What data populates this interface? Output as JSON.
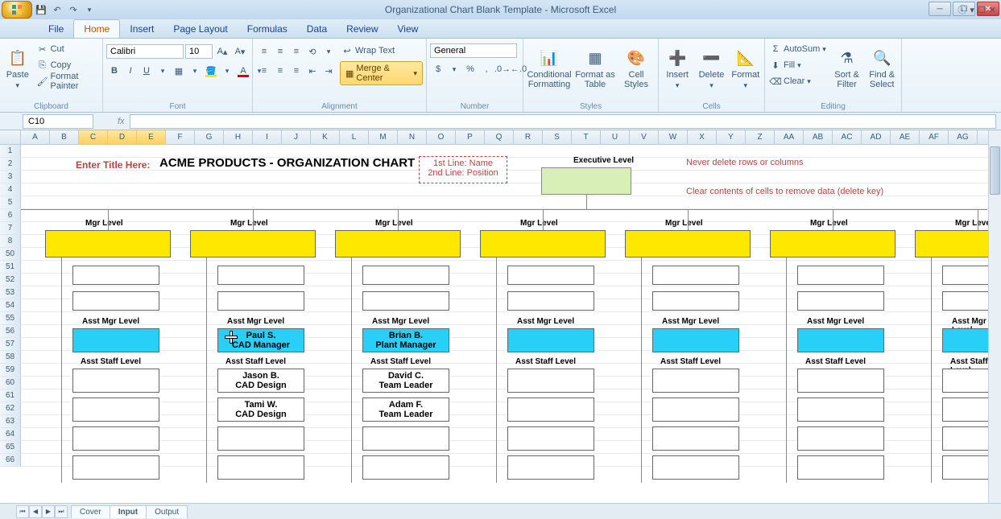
{
  "window": {
    "title": "Organizational Chart Blank Template - Microsoft Excel"
  },
  "tabs": [
    "File",
    "Home",
    "Insert",
    "Page Layout",
    "Formulas",
    "Data",
    "Review",
    "View"
  ],
  "active_tab": "Home",
  "clipboard": {
    "paste": "Paste",
    "cut": "Cut",
    "copy": "Copy",
    "fp": "Format Painter",
    "label": "Clipboard"
  },
  "font": {
    "name": "Calibri",
    "size": "10",
    "label": "Font"
  },
  "alignment": {
    "wrap": "Wrap Text",
    "merge": "Merge & Center",
    "label": "Alignment"
  },
  "number": {
    "fmt": "General",
    "label": "Number"
  },
  "styles": {
    "cf": "Conditional Formatting",
    "fat": "Format as Table",
    "cs": "Cell Styles",
    "label": "Styles"
  },
  "cells": {
    "ins": "Insert",
    "del": "Delete",
    "fmt": "Format",
    "label": "Cells"
  },
  "editing": {
    "as": "AutoSum",
    "fill": "Fill",
    "clr": "Clear",
    "sort": "Sort & Filter",
    "find": "Find & Select",
    "label": "Editing"
  },
  "namebox": "C10",
  "cols": [
    "A",
    "B",
    "C",
    "D",
    "E",
    "F",
    "G",
    "H",
    "I",
    "J",
    "K",
    "L",
    "M",
    "N",
    "O",
    "P",
    "Q",
    "R",
    "S",
    "T",
    "U",
    "V",
    "W",
    "X",
    "Y",
    "Z",
    "AA",
    "AB",
    "AC",
    "AD",
    "AE",
    "AF",
    "AG"
  ],
  "sel_cols": [
    "C",
    "D",
    "E"
  ],
  "row_labels": [
    "1",
    "2",
    "3",
    "4",
    "5",
    "6",
    "7",
    "8",
    "50",
    "51",
    "52",
    "53",
    "54",
    "55",
    "56",
    "57",
    "58",
    "59",
    "60",
    "61",
    "62",
    "63",
    "64",
    "65",
    "66"
  ],
  "sheet": {
    "prompt": "Enter Title Here:",
    "title": "ACME PRODUCTS - ORGANIZATION CHART",
    "legend1": "1st Line: Name",
    "legend2": "2nd Line: Position",
    "exec": "Executive Level",
    "warn1": "Never delete rows or columns",
    "warn2": "Clear contents of cells to remove data (delete key)",
    "mgr": "Mgr Level",
    "amgr": "Asst Mgr Level",
    "astaff": "Asst Staff Level",
    "paul_n": "Paul S.",
    "paul_p": "CAD Manager",
    "brian_n": "Brian B.",
    "brian_p": "Plant Manager",
    "jason_n": "Jason B.",
    "jason_p": "CAD Design",
    "david_n": "David C.",
    "david_p": "Team Leader",
    "tami_n": "Tami W.",
    "tami_p": "CAD Design",
    "adam_n": "Adam F.",
    "adam_p": "Team Leader"
  },
  "sheets": [
    "Cover",
    "Input",
    "Output"
  ]
}
